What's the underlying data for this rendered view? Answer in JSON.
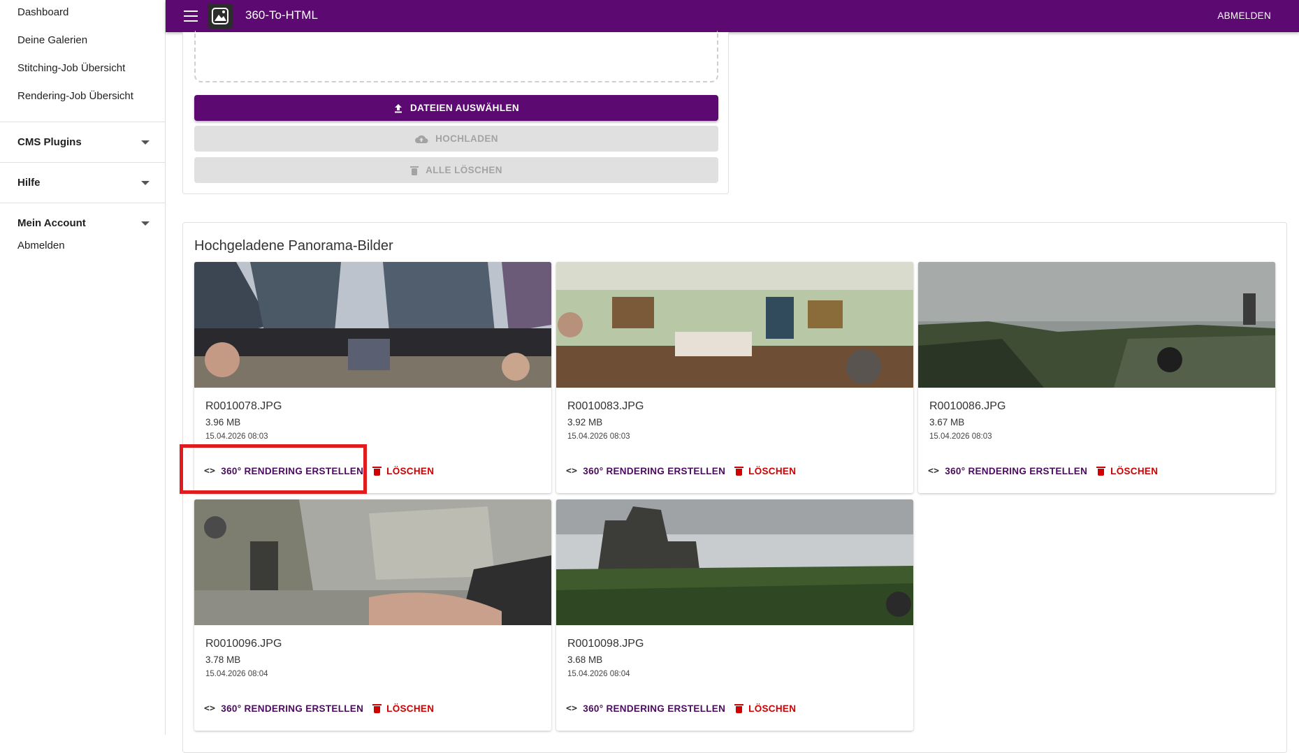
{
  "app": {
    "title": "360-To-HTML",
    "logout_label": "ABMELDEN"
  },
  "sidebar": {
    "links": [
      {
        "label": "Dashboard"
      },
      {
        "label": "Deine Galerien"
      },
      {
        "label": "Stitching-Job Übersicht"
      },
      {
        "label": "Rendering-Job Übersicht"
      }
    ],
    "groups": {
      "cms": "CMS Plugins",
      "help": "Hilfe",
      "account": "Mein Account"
    },
    "account_logout": "Abmelden"
  },
  "upload": {
    "select_label": "DATEIEN AUSWÄHLEN",
    "upload_label": "HOCHLADEN",
    "clear_label": "ALLE LÖSCHEN"
  },
  "gallery": {
    "title": "Hochgeladene Panorama-Bilder",
    "render_label": "360° RENDERING ERSTELLEN",
    "delete_label": "LÖSCHEN",
    "images": [
      {
        "name": "R0010078.JPG",
        "size": "3.96 MB",
        "date": "15.04.2026 08:03"
      },
      {
        "name": "R0010083.JPG",
        "size": "3.92 MB",
        "date": "15.04.2026 08:03"
      },
      {
        "name": "R0010086.JPG",
        "size": "3.67 MB",
        "date": "15.04.2026 08:03"
      },
      {
        "name": "R0010096.JPG",
        "size": "3.78 MB",
        "date": "15.04.2026 08:04"
      },
      {
        "name": "R0010098.JPG",
        "size": "3.68 MB",
        "date": "15.04.2026 08:04"
      }
    ]
  },
  "colors": {
    "primary": "#5c0a72",
    "danger": "#d10000",
    "highlight": "#e01c1c"
  },
  "icons": [
    "menu-icon",
    "logo-icon",
    "upload-icon",
    "cloud-upload-icon",
    "trash-icon",
    "code-icon",
    "chevron-down-icon"
  ]
}
